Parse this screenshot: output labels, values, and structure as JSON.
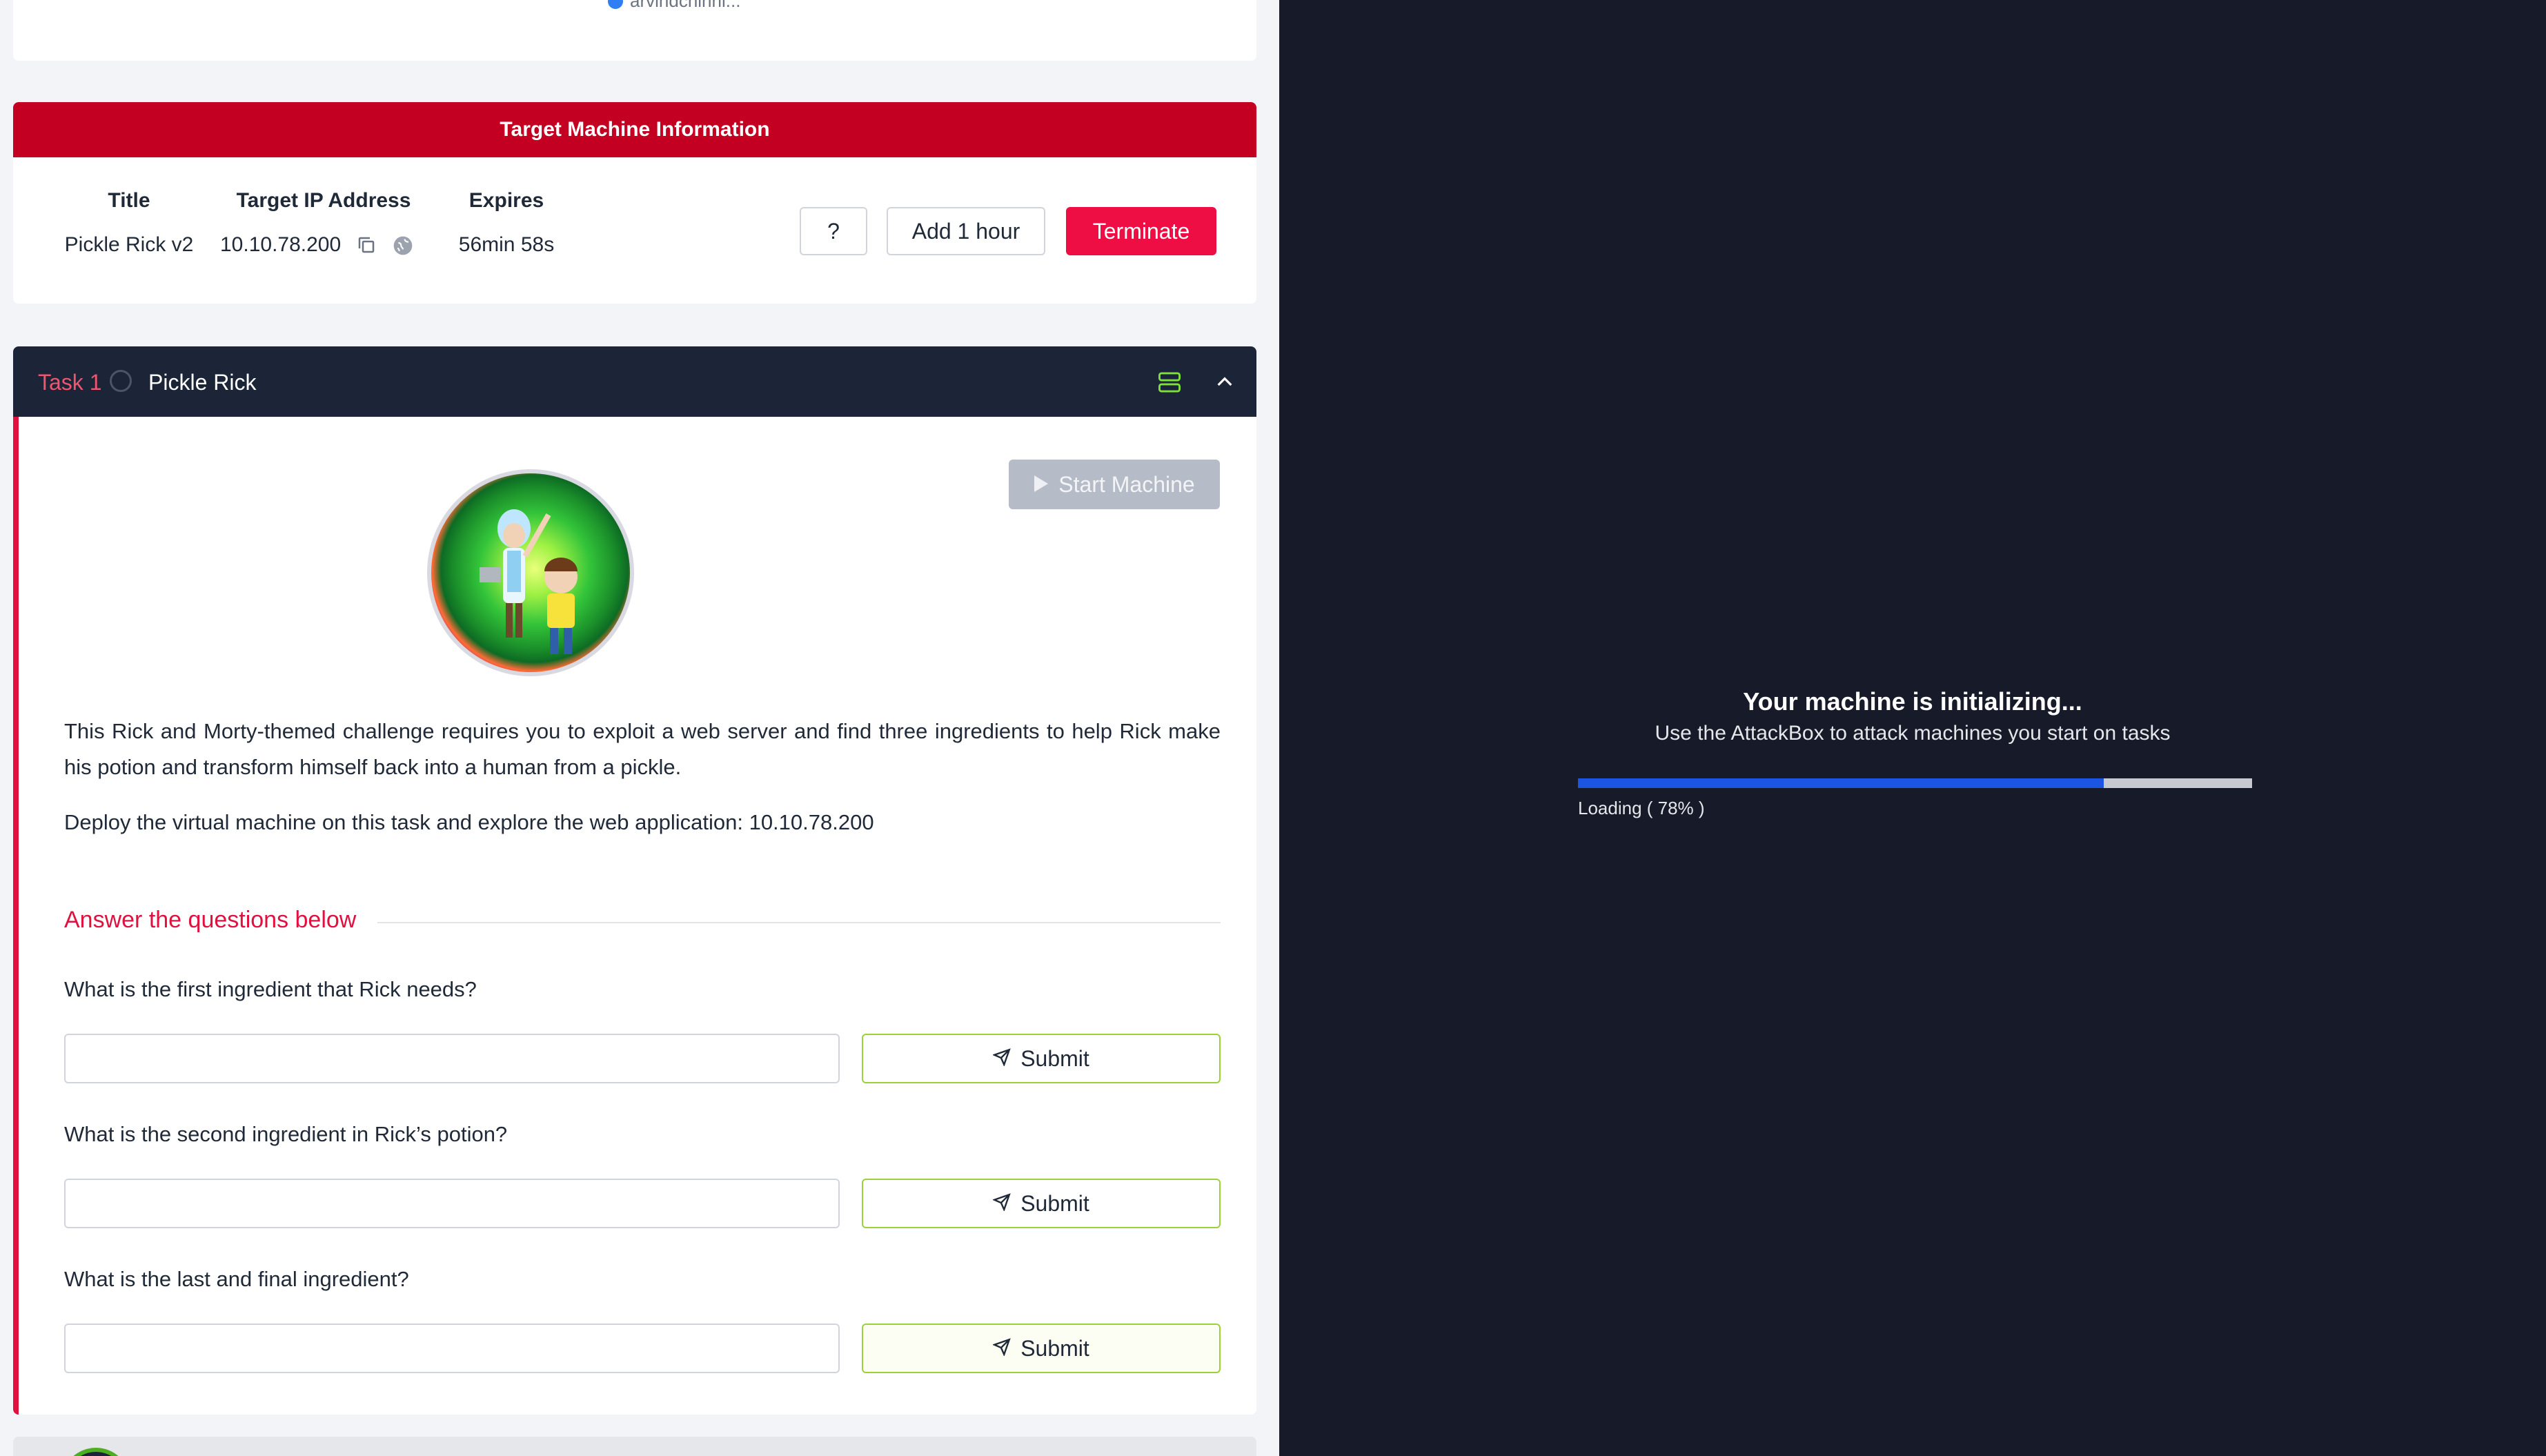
{
  "header_card": {
    "author": "arvindchinni..."
  },
  "target_machine": {
    "heading": "Target Machine Information",
    "title_label": "Title",
    "title_value": "Pickle Rick v2",
    "ip_label": "Target IP Address",
    "ip_value": "10.10.78.200",
    "expires_label": "Expires",
    "expires_value": "56min 58s",
    "help_label": "?",
    "add_hour_label": "Add 1 hour",
    "terminate_label": "Terminate"
  },
  "task": {
    "number": "Task 1",
    "name": "Pickle Rick",
    "start_machine_label": "Start Machine",
    "description": "This Rick and Morty-themed challenge requires you to exploit a web server and find three ingredients to help Rick make his potion and transform himself back into a human from a pickle.",
    "deploy_text": "Deploy the virtual machine on this task and explore the web application: 10.10.78.200",
    "answer_heading": "Answer the questions below",
    "questions": [
      {
        "text": "What is the first ingredient that Rick needs?",
        "value": "",
        "submit": "Submit"
      },
      {
        "text": "What is the second ingredient in Rick’s potion?",
        "value": "",
        "submit": "Submit"
      },
      {
        "text": "What is the last and final ingredient?",
        "value": "",
        "submit": "Submit"
      }
    ]
  },
  "attackbox": {
    "title": "Your machine is initializing...",
    "subtitle": "Use the AttackBox to attack machines you start on tasks",
    "progress": 0.78,
    "loading_text": "Loading ( 78% )"
  },
  "colors": {
    "accent_red": "#c30021",
    "terminate": "#ef0e44",
    "task_header": "#1c2538",
    "submit_border": "#9bd13b",
    "progress_fill": "#1b55e2",
    "right_bg": "#171b29"
  }
}
